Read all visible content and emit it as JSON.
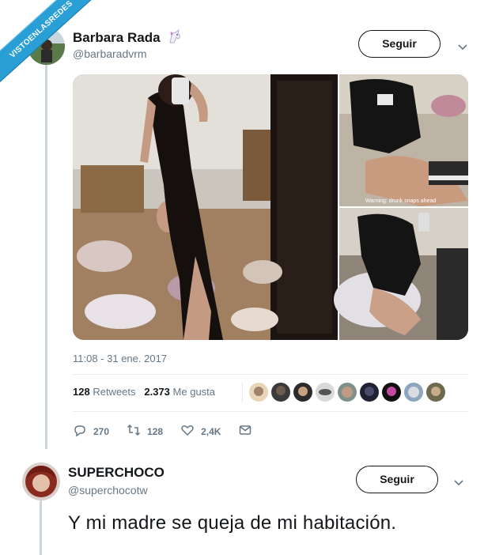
{
  "watermark": "VISTOENLASREDES",
  "tweet": {
    "author_name": "Barbara Rada",
    "author_emoji": "unicorn-icon",
    "author_handle": "@barbaradvrm",
    "follow_label": "Seguir",
    "media_caption": "Warning: drunk snaps ahead",
    "timestamp": "11:08 - 31 ene. 2017",
    "retweets_count": "128",
    "retweets_label": "Retweets",
    "likes_count": "2.373",
    "likes_label": "Me gusta",
    "replies": "270",
    "retweets_action": "128",
    "likes_action": "2,4K",
    "liker_avatars": 9
  },
  "reply": {
    "author_name": "SUPERCHOCO",
    "author_handle": "@superchocotw",
    "follow_label": "Seguir",
    "text": "Y mi madre se queja de mi habitación."
  },
  "colors": {
    "accent": "#1da1f2",
    "muted": "#657786",
    "ribbon": "#2a9fd6"
  }
}
